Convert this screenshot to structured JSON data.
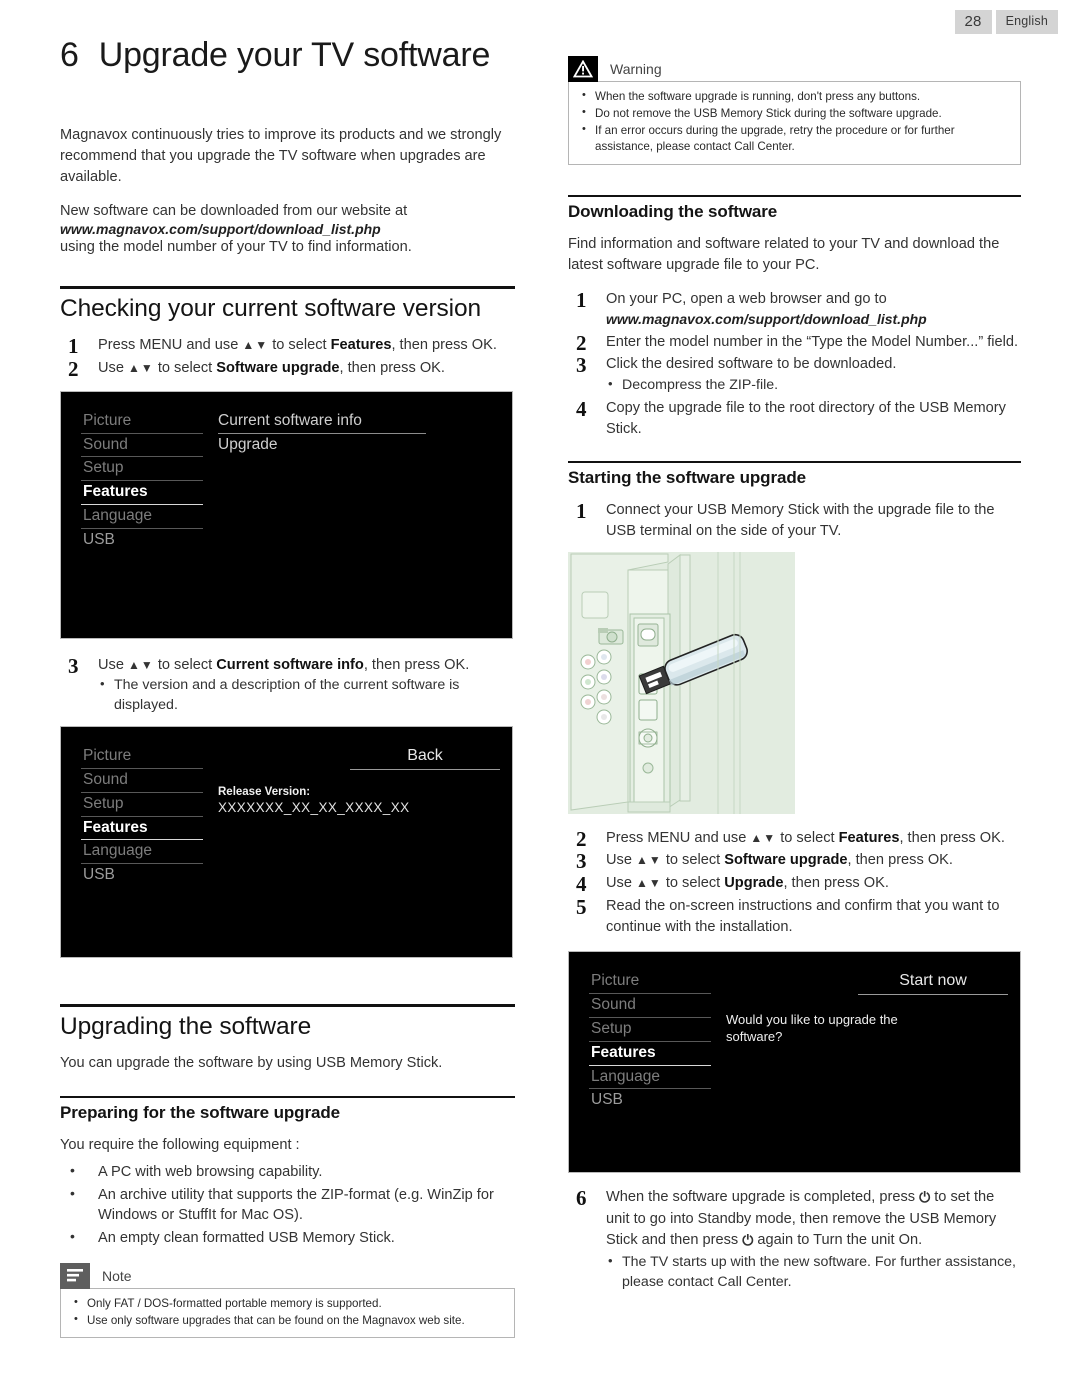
{
  "header": {
    "page_number": "28",
    "language": "English"
  },
  "chapter": {
    "number": "6",
    "title": "Upgrade your TV software"
  },
  "intro": {
    "para1": "Magnavox continuously tries to improve its products and we strongly recommend that you upgrade the TV software when upgrades are available.",
    "para2_lead": "New software can be downloaded from our website at",
    "url": "www.magnavox.com/support/download_list.php",
    "para2_tail": "using the model number of your TV to find information."
  },
  "checking": {
    "heading": "Checking your current software version",
    "step1_a": "Press MENU and use ",
    "step1_arrows": "▲▼",
    "step1_b": " to select ",
    "step1_bold": "Features",
    "step1_c": ", then press OK.",
    "step2_a": "Use ",
    "step2_arrows": "▲▼",
    "step2_b": " to select ",
    "step2_bold": "Software upgrade",
    "step2_c": ", then press OK.",
    "step3_a": "Use ",
    "step3_arrows": "▲▼",
    "step3_b": " to select ",
    "step3_bold": "Current software info",
    "step3_c": ", then press OK.",
    "step3_bullet": "The version and a description of the current software is displayed."
  },
  "osd_menu_items": [
    "Picture",
    "Sound",
    "Setup",
    "Features",
    "Language",
    "USB"
  ],
  "osd1": {
    "option_current": "Current software info",
    "option_upgrade": "Upgrade"
  },
  "osd2": {
    "back_label": "Back",
    "release_label": "Release Version:",
    "release_value": "XXXXXXX_XX_XX_XXXX_XX"
  },
  "osd3": {
    "start_now_label": "Start now",
    "message": "Would you like to upgrade the software?"
  },
  "upgrading": {
    "heading": "Upgrading the software",
    "intro": "You can upgrade the software by using USB Memory Stick.",
    "sub_heading": "Preparing for the software upgrade",
    "requirement_lead": "You require the following equipment :",
    "requirements": [
      "A PC with web browsing capability.",
      "An archive utility that supports the ZIP-format (e.g. WinZip for Windows or StuffIt for Mac OS).",
      "An empty clean formatted USB Memory Stick."
    ]
  },
  "note": {
    "title": "Note",
    "items": [
      "Only FAT / DOS-formatted portable memory is supported.",
      "Use only software upgrades that can be found on the Magnavox web site."
    ]
  },
  "warning": {
    "title": "Warning",
    "items": [
      "When the software upgrade is running, don't press any buttons.",
      "Do not remove the USB Memory Stick during the software upgrade.",
      "If an error occurs during the upgrade, retry the procedure or for further assistance, please contact Call Center."
    ]
  },
  "downloading": {
    "heading": "Downloading the software",
    "intro": "Find information and software related to your TV and download the latest software upgrade file to your PC.",
    "step1": "On your PC, open a web browser and go to",
    "step1_url": "www.magnavox.com/support/download_list.php",
    "step2": "Enter the model number in the “Type the Model Number...” field.",
    "step3": "Click the desired software to be downloaded.",
    "step3_bullet": "Decompress the ZIP-file.",
    "step4": "Copy the upgrade file to the root directory of the USB Memory Stick."
  },
  "starting": {
    "heading": "Starting the software upgrade",
    "step1": "Connect your USB Memory Stick with the upgrade file to the USB terminal on the side of your TV.",
    "step2_a": "Press MENU and use ",
    "step2_arrows": "▲▼",
    "step2_b": " to select ",
    "step2_bold": "Features",
    "step2_c": ", then press OK.",
    "step3_a": "Use ",
    "step3_arrows": "▲▼",
    "step3_b": " to select ",
    "step3_bold": "Software upgrade",
    "step3_c": ", then press OK.",
    "step4_a": "Use ",
    "step4_arrows": "▲▼",
    "step4_b": " to select ",
    "step4_bold": "Upgrade",
    "step4_c": ", then press OK.",
    "step5": "Read the on-screen instructions and confirm that you want to continue with the installation.",
    "step6_a": "When the software upgrade is completed, press ",
    "step6_power": "⏻",
    "step6_b": " to set the unit to go into Standby mode, then remove the USB Memory Stick and then press ",
    "step6_power2": "⏻",
    "step6_c": " again to Turn the unit On.",
    "step6_bullet": "The TV starts up with the new software. For further assistance, please contact Call Center."
  },
  "colors": {
    "badge_bg": "#d4d4d4",
    "note_icon_bg": "#5e5e5e",
    "warning_icon_bg": "#000000",
    "osd_bg": "#000000",
    "illustration_bg": "#e2ece0"
  }
}
